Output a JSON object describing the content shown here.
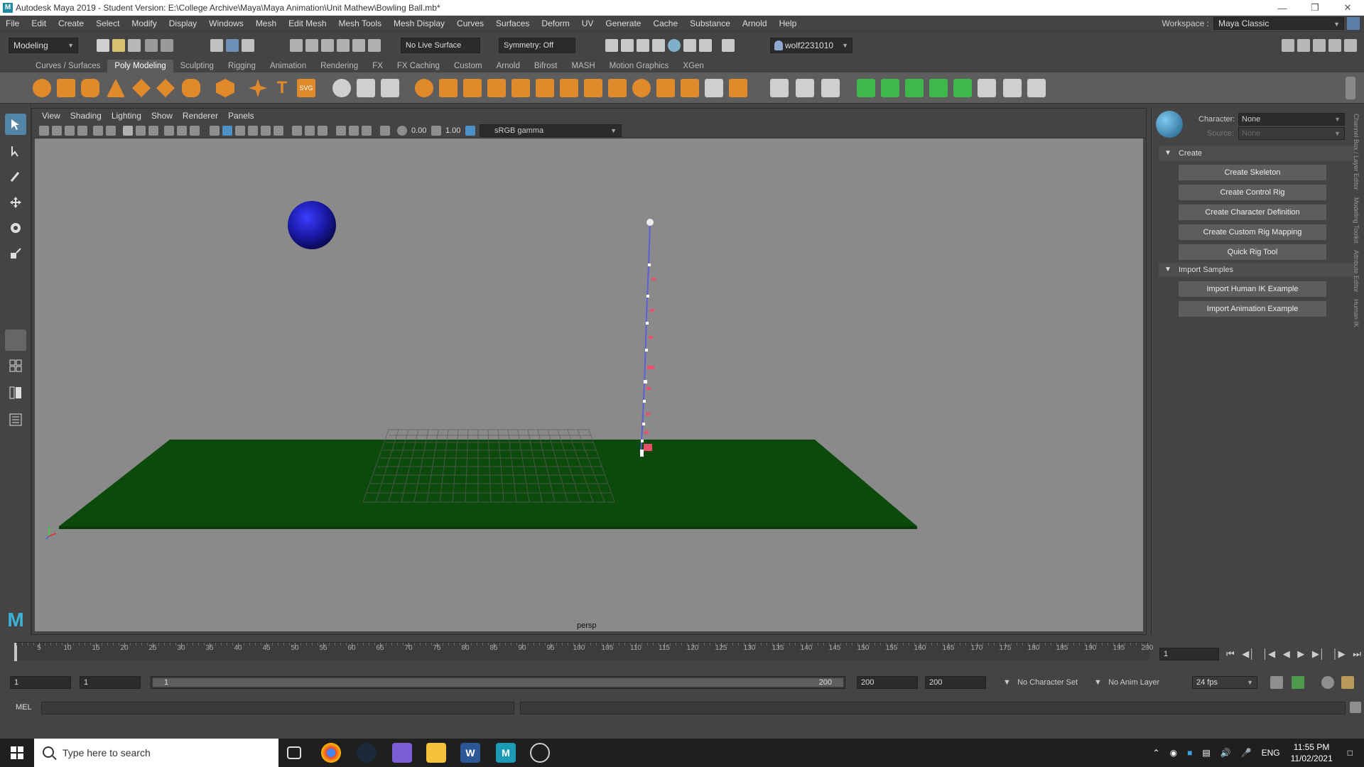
{
  "window": {
    "title": "Autodesk Maya 2019 - Student Version: E:\\College Archive\\Maya\\Maya Animation\\Unit Mathew\\Bowling Ball.mb*"
  },
  "menubar": {
    "items": [
      "File",
      "Edit",
      "Create",
      "Select",
      "Modify",
      "Display",
      "Windows",
      "Mesh",
      "Edit Mesh",
      "Mesh Tools",
      "Mesh Display",
      "Curves",
      "Surfaces",
      "Deform",
      "UV",
      "Generate",
      "Cache",
      "Substance",
      "Arnold",
      "Help"
    ]
  },
  "workspace": {
    "label": "Workspace :",
    "value": "Maya Classic"
  },
  "statusline": {
    "mode": "Modeling",
    "live_surface": "No Live Surface",
    "symmetry": "Symmetry: Off",
    "user": "wolf2231010"
  },
  "shelf": {
    "tabs": [
      "Curves / Surfaces",
      "Poly Modeling",
      "Sculpting",
      "Rigging",
      "Animation",
      "Rendering",
      "FX",
      "FX Caching",
      "Custom",
      "Arnold",
      "Bifrost",
      "MASH",
      "Motion Graphics",
      "XGen"
    ],
    "active_tab": "Poly Modeling"
  },
  "viewport": {
    "menu": [
      "View",
      "Shading",
      "Lighting",
      "Show",
      "Renderer",
      "Panels"
    ],
    "exposure": "0.00",
    "gamma": "1.00",
    "color_space": "sRGB gamma",
    "camera": "persp",
    "colors": {
      "background": "#8a8a8a",
      "ground": "#0b4a0b",
      "ball": "#1a1aa8"
    }
  },
  "hik": {
    "character_label": "Character:",
    "character_value": "None",
    "source_label": "Source:",
    "source_value": "None",
    "create_section": "Create",
    "create_buttons": [
      "Create Skeleton",
      "Create Control Rig",
      "Create Character Definition",
      "Create Custom Rig Mapping",
      "Quick Rig Tool"
    ],
    "import_section": "Import Samples",
    "import_buttons": [
      "Import Human IK Example",
      "Import Animation Example"
    ]
  },
  "side_tabs": [
    "Channel Box / Layer Editor",
    "Modeling Toolkit",
    "Attribute Editor",
    "Human IK"
  ],
  "timeline": {
    "ticks": [
      "5",
      "10",
      "15",
      "20",
      "25",
      "30",
      "35",
      "40",
      "45",
      "50",
      "55",
      "60",
      "65",
      "70",
      "75",
      "80",
      "85",
      "90",
      "95",
      "100",
      "105",
      "110",
      "115",
      "120",
      "125",
      "130",
      "135",
      "140",
      "145",
      "150",
      "155",
      "160",
      "165",
      "170",
      "175",
      "180",
      "185",
      "190",
      "195",
      "200"
    ],
    "current_frame": "1"
  },
  "range": {
    "start": "1",
    "playback_start": "1",
    "slider_start": "1",
    "slider_end": "200",
    "playback_end": "200",
    "end": "200",
    "character_set": "No Character Set",
    "anim_layer": "No Anim Layer",
    "fps": "24 fps"
  },
  "cmdline": {
    "label": "MEL"
  },
  "taskbar": {
    "search_placeholder": "Type here to search",
    "language": "ENG",
    "time": "11:55 PM",
    "date": "11/02/2021"
  }
}
